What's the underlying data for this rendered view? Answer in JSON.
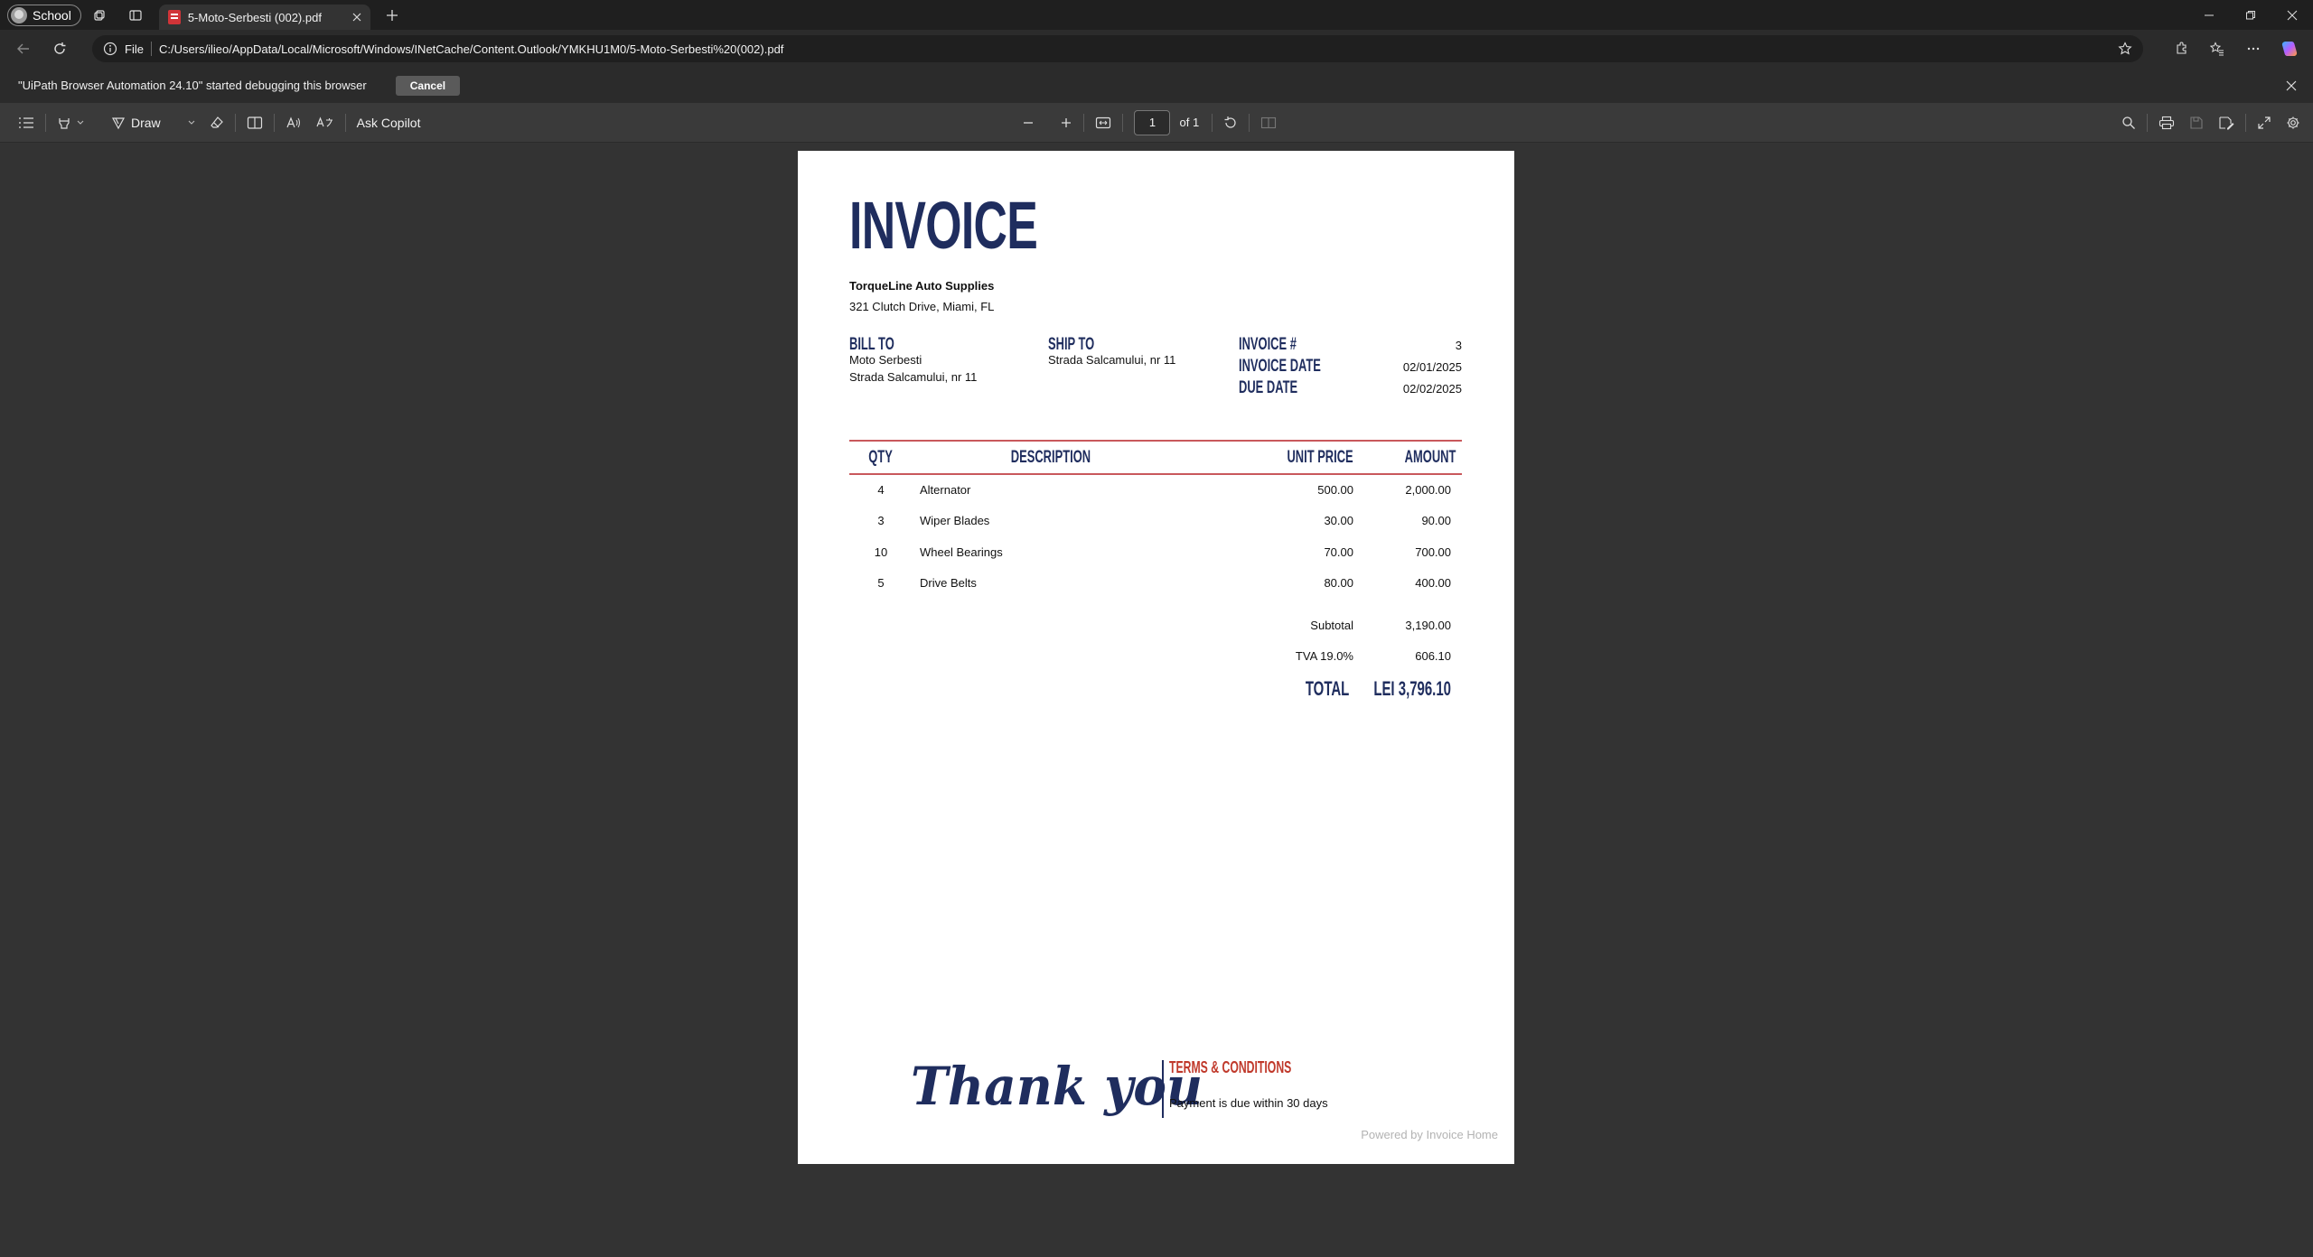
{
  "browser": {
    "profile_label": "School",
    "tab_title": "5-Moto-Serbesti (002).pdf",
    "address_scheme": "File",
    "url": "C:/Users/ilieo/AppData/Local/Microsoft/Windows/INetCache/Content.Outlook/YMKHU1M0/5-Moto-Serbesti%20(002).pdf"
  },
  "infobar": {
    "message": "\"UiPath Browser Automation 24.10\" started debugging this browser",
    "cancel_label": "Cancel"
  },
  "pdf_toolbar": {
    "draw_label": "Draw",
    "ask_copilot_label": "Ask Copilot",
    "page_number": "1",
    "page_total_label": "of 1"
  },
  "invoice": {
    "title": "INVOICE",
    "company_name": "TorqueLine Auto Supplies",
    "company_address": "321 Clutch Drive, Miami, FL",
    "bill_to_label": "BILL TO",
    "bill_to_name": "Moto Serbesti",
    "bill_to_address": "Strada Salcamului, nr 11",
    "ship_to_label": "SHIP TO",
    "ship_to_address": "Strada Salcamului, nr 11",
    "invoice_no_label": "INVOICE #",
    "invoice_no": "3",
    "invoice_date_label": "INVOICE DATE",
    "invoice_date": "02/01/2025",
    "due_date_label": "DUE DATE",
    "due_date": "02/02/2025",
    "columns": {
      "qty": "QTY",
      "description": "DESCRIPTION",
      "unit_price": "UNIT PRICE",
      "amount": "AMOUNT"
    },
    "items": [
      {
        "qty": "4",
        "description": "Alternator",
        "unit_price": "500.00",
        "amount": "2,000.00"
      },
      {
        "qty": "3",
        "description": "Wiper Blades",
        "unit_price": "30.00",
        "amount": "90.00"
      },
      {
        "qty": "10",
        "description": "Wheel Bearings",
        "unit_price": "70.00",
        "amount": "700.00"
      },
      {
        "qty": "5",
        "description": "Drive Belts",
        "unit_price": "80.00",
        "amount": "400.00"
      }
    ],
    "subtotal_label": "Subtotal",
    "subtotal": "3,190.00",
    "tax_label": "TVA 19.0%",
    "tax": "606.10",
    "total_label": "TOTAL",
    "total": "LEI 3,796.10",
    "thank_you": "Thank you",
    "terms_title": "TERMS & CONDITIONS",
    "terms_text": "Payment is due within 30 days",
    "powered_by": "Powered by Invoice Home"
  },
  "colors": {
    "accent_navy": "#1f2d5e",
    "rule_red": "#c9585c",
    "terms_red": "#c0392b"
  }
}
